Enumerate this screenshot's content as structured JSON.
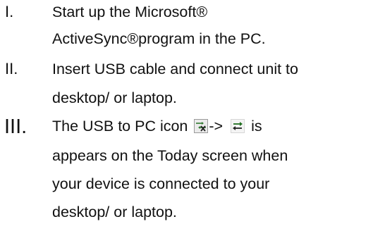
{
  "steps": [
    {
      "numeral": "I.",
      "lines": [
        "Start up the Microsoft®",
        "ActiveSync®program in the PC."
      ]
    },
    {
      "numeral": "II.",
      "lines": [
        "Insert USB cable and connect unit to",
        "desktop/ or laptop."
      ]
    },
    {
      "numeral": "III.",
      "line1_before_icon": "The USB to PC icon",
      "line1_arrow": "->",
      "line1_after_icon": "is",
      "icons": [
        "usb-disconnected-icon",
        "usb-connected-icon"
      ],
      "lines": [
        "appears on the Today screen when",
        "your device is connected to your",
        "desktop/ or laptop."
      ]
    }
  ]
}
